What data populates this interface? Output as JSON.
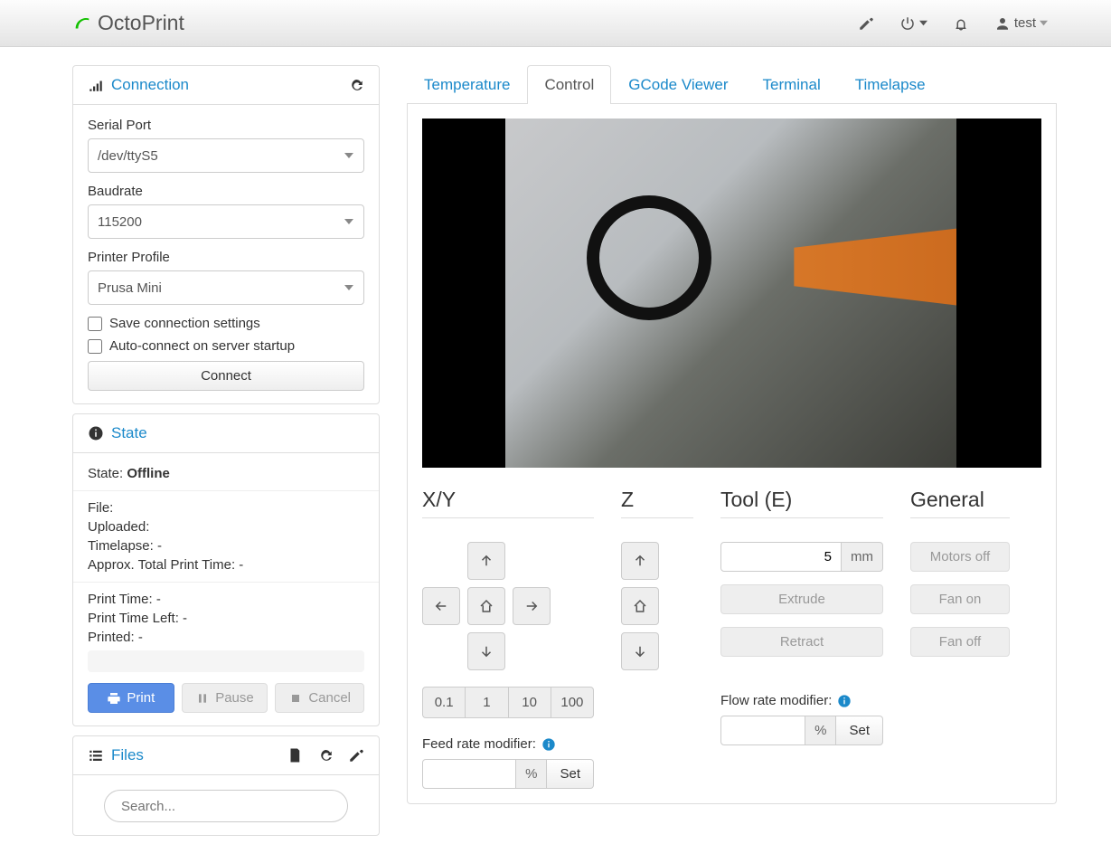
{
  "brand": "OctoPrint",
  "user": "test",
  "sidebar": {
    "connection": {
      "title": "Connection",
      "serialPortLabel": "Serial Port",
      "serialPort": "/dev/ttyS5",
      "baudrateLabel": "Baudrate",
      "baudrate": "115200",
      "profileLabel": "Printer Profile",
      "profile": "Prusa Mini",
      "saveLabel": "Save connection settings",
      "autoLabel": "Auto-connect on server startup",
      "connectBtn": "Connect"
    },
    "state": {
      "title": "State",
      "stateLabel": "State: ",
      "stateValue": "Offline",
      "file": "File:",
      "uploaded": "Uploaded:",
      "timelapse": "Timelapse: -",
      "approx": "Approx. Total Print Time: -",
      "printTime": "Print Time: -",
      "printTimeLeft": "Print Time Left: -",
      "printed": "Printed: -",
      "printBtn": "Print",
      "pauseBtn": "Pause",
      "cancelBtn": "Cancel"
    },
    "files": {
      "title": "Files",
      "searchPlaceholder": "Search..."
    }
  },
  "tabs": [
    "Temperature",
    "Control",
    "GCode Viewer",
    "Terminal",
    "Timelapse"
  ],
  "activeTab": "Control",
  "control": {
    "xyTitle": "X/Y",
    "zTitle": "Z",
    "toolTitle": "Tool (E)",
    "generalTitle": "General",
    "steps": [
      "0.1",
      "1",
      "10",
      "100"
    ],
    "toolAmount": "5",
    "toolUnit": "mm",
    "extrude": "Extrude",
    "retract": "Retract",
    "motorsOff": "Motors off",
    "fanOn": "Fan on",
    "fanOff": "Fan off",
    "feedLabel": "Feed rate modifier:",
    "flowLabel": "Flow rate modifier:",
    "percent": "%",
    "set": "Set"
  }
}
